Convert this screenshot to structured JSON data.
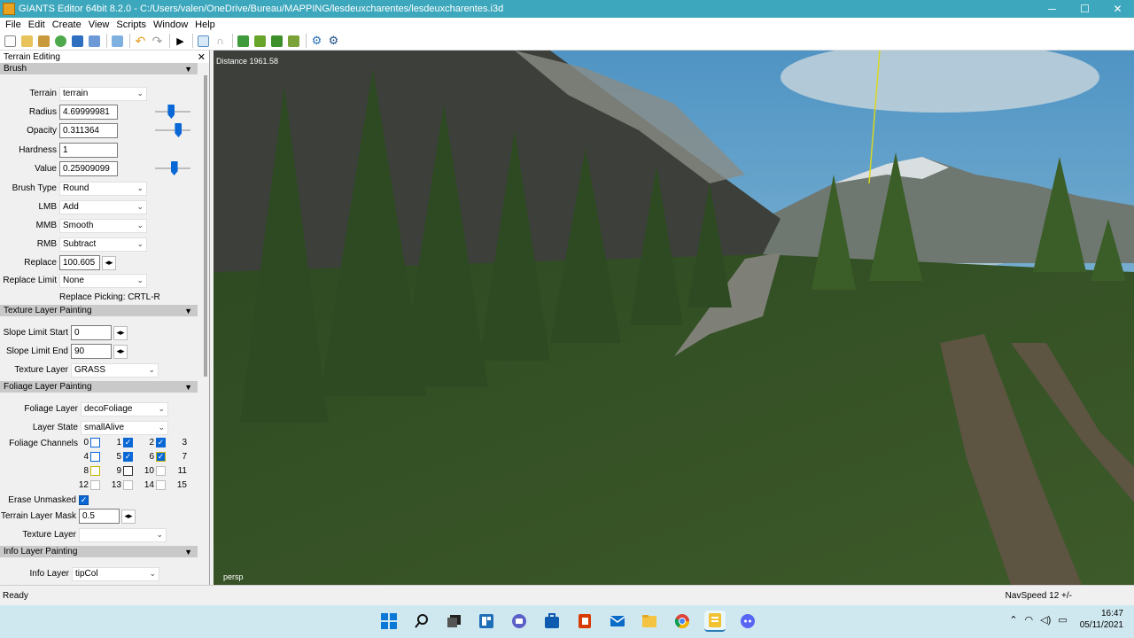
{
  "window": {
    "title": "GIANTS Editor 64bit 8.2.0 - C:/Users/valen/OneDrive/Bureau/MAPPING/lesdeuxcharentes/lesdeuxcharentes.i3d",
    "minimize": "─",
    "maximize": "☐",
    "close": "✕"
  },
  "menu": [
    "File",
    "Edit",
    "Create",
    "View",
    "Scripts",
    "Window",
    "Help"
  ],
  "panel": {
    "title": "Terrain Editing",
    "close": "✕",
    "brush": {
      "header": "Brush",
      "terrain_label": "Terrain",
      "terrain_value": "terrain",
      "radius_label": "Radius",
      "radius_value": "4.69999981",
      "radius_level": 0.45,
      "opacity_label": "Opacity",
      "opacity_value": "0.311364",
      "opacity_level": 0.7,
      "hardness_label": "Hardness",
      "hardness_value": "1",
      "value_label": "Value",
      "value_value": "0.25909099",
      "value_level": 0.55,
      "brush_type_label": "Brush Type",
      "brush_type_value": "Round",
      "lmb_label": "LMB",
      "lmb_value": "Add",
      "mmb_label": "MMB",
      "mmb_value": "Smooth",
      "rmb_label": "RMB",
      "rmb_value": "Subtract",
      "replace_label": "Replace",
      "replace_value": "100.605",
      "replace_limit_label": "Replace Limit",
      "replace_limit_value": "None",
      "replace_picking": "Replace Picking: CRTL-R"
    },
    "texture": {
      "header": "Texture Layer Painting",
      "slope_start_label": "Slope Limit Start",
      "slope_start_value": "0",
      "slope_end_label": "Slope Limit End",
      "slope_end_value": "90",
      "texture_layer_label": "Texture Layer",
      "texture_layer_value": "GRASS"
    },
    "foliage": {
      "header": "Foliage Layer Painting",
      "foliage_layer_label": "Foliage Layer",
      "foliage_layer_value": "decoFoliage",
      "layer_state_label": "Layer State",
      "layer_state_value": "smallAlive",
      "channels_label": "Foliage Channels",
      "channels": [
        {
          "n": "0",
          "checked": false,
          "style": "blue"
        },
        {
          "n": "1",
          "checked": true,
          "style": "blue"
        },
        {
          "n": "2",
          "checked": true,
          "style": "blue"
        },
        {
          "n": "3",
          "checked": null,
          "style": "none"
        },
        {
          "n": "4",
          "checked": false,
          "style": "blue"
        },
        {
          "n": "5",
          "checked": true,
          "style": "blue"
        },
        {
          "n": "6",
          "checked": true,
          "style": "yellow"
        },
        {
          "n": "7",
          "checked": null,
          "style": "none"
        },
        {
          "n": "8",
          "checked": false,
          "style": "yellow"
        },
        {
          "n": "9",
          "checked": false,
          "style": "dark"
        },
        {
          "n": "10",
          "checked": false,
          "style": "light"
        },
        {
          "n": "11",
          "checked": null,
          "style": "none"
        },
        {
          "n": "12",
          "checked": false,
          "style": "light"
        },
        {
          "n": "13",
          "checked": false,
          "style": "light"
        },
        {
          "n": "14",
          "checked": false,
          "style": "light"
        },
        {
          "n": "15",
          "checked": null,
          "style": "none"
        }
      ],
      "erase_unmasked_label": "Erase Unmasked",
      "erase_unmasked_checked": true,
      "terrain_layer_mask_label": "Terrain Layer Mask",
      "terrain_layer_mask_value": "0.5",
      "texture_layer_label": "Texture Layer",
      "texture_layer_value": ""
    },
    "info": {
      "header": "Info Layer Painting",
      "info_layer_label": "Info Layer",
      "info_layer_value": "tipCol"
    }
  },
  "viewport": {
    "distance": "Distance 1961.58",
    "camera": "persp"
  },
  "status": {
    "left": "Ready",
    "right": "NavSpeed 12 +/-"
  },
  "taskbar": {
    "icons": [
      "windows-start-icon",
      "search-icon",
      "task-view-icon",
      "widgets-icon",
      "chat-icon",
      "store-icon",
      "office-icon",
      "mail-icon",
      "file-explorer-icon",
      "chrome-icon",
      "giants-editor-icon",
      "discord-icon"
    ],
    "time": "16:47",
    "date": "05/11/2021"
  },
  "colors": {
    "titlebar": "#3da8bd",
    "accent": "#0a68d6",
    "taskbar": "#cfe8f0"
  }
}
